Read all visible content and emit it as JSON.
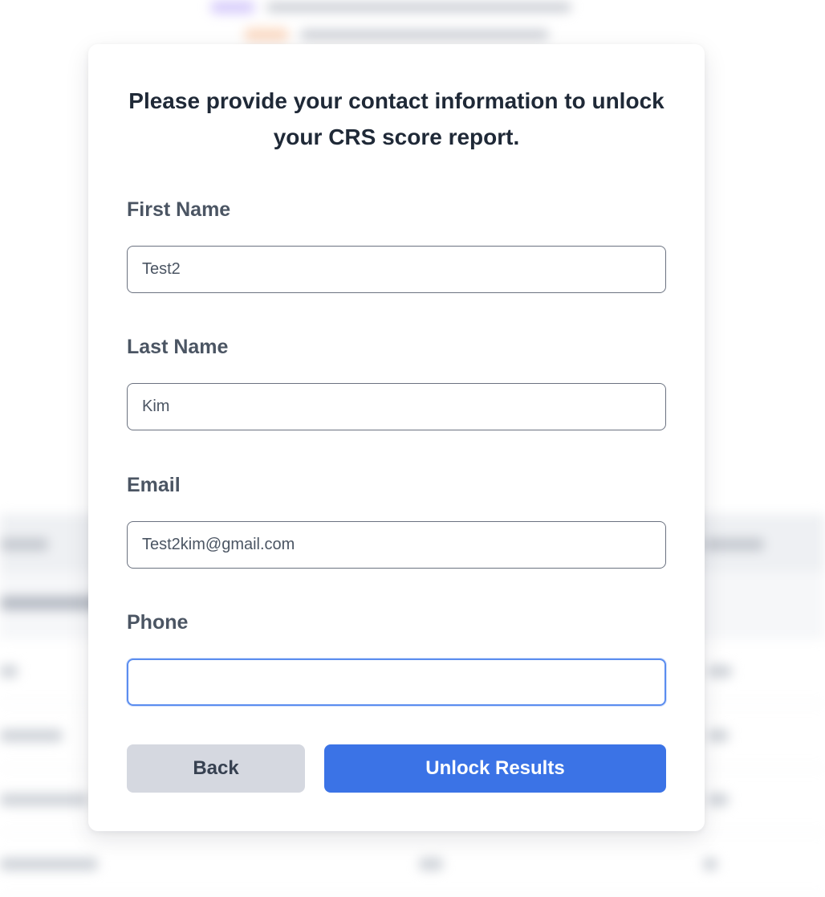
{
  "modal": {
    "title": "Please provide your contact information to unlock your CRS score report."
  },
  "form": {
    "first_name": {
      "label": "First Name",
      "value": "Test2"
    },
    "last_name": {
      "label": "Last Name",
      "value": "Kim"
    },
    "email": {
      "label": "Email",
      "value": "Test2kim@gmail.com"
    },
    "phone": {
      "label": "Phone",
      "value": ""
    }
  },
  "actions": {
    "back_label": "Back",
    "unlock_label": "Unlock Results"
  },
  "colors": {
    "primary": "#3b73e6",
    "secondary": "#d5d8e0",
    "focus_ring": "#5b8def",
    "heading": "#1f2937",
    "label": "#4b5563"
  }
}
